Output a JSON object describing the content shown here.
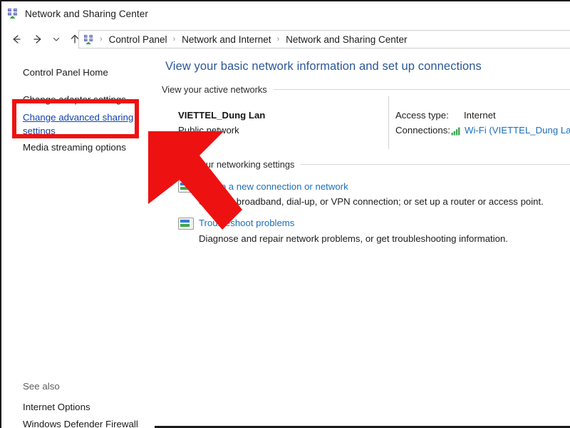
{
  "window": {
    "title": "Network and Sharing Center",
    "icon": "network-sharing-icon"
  },
  "navbar": {
    "back_icon": "back-arrow-icon",
    "forward_icon": "forward-arrow-icon",
    "recent_icon": "chevron-down-icon",
    "up_icon": "up-arrow-icon",
    "path_icon": "network-sharing-icon",
    "breadcrumbs": [
      "Control Panel",
      "Network and Internet",
      "Network and Sharing Center"
    ],
    "separator": "›"
  },
  "sidebar": {
    "items": [
      {
        "label": "Control Panel Home",
        "style": "plain"
      },
      {
        "label": "Change adapter settings",
        "style": "plain"
      },
      {
        "label": "Change advanced sharing",
        "style": "blue"
      },
      {
        "label": "settings",
        "style": "blue"
      },
      {
        "label": "Media streaming options",
        "style": "plain"
      }
    ],
    "see_also_heading": "See also",
    "see_also": [
      "Internet Options",
      "Windows Defender Firewall"
    ]
  },
  "main": {
    "heading": "View your basic network information and set up connections",
    "active_networks_label": "View your active networks",
    "network": {
      "name": "VIETTEL_Dung Lan",
      "type": "Public network",
      "access_type_label": "Access type:",
      "access_type_value": "Internet",
      "connections_label": "Connections:",
      "connections_icon": "wifi-signal-icon",
      "connections_value": "Wi-Fi (VIETTEL_Dung Lan)"
    },
    "networking_settings_label": "Change your networking settings",
    "setup_connection": {
      "link": "Set up a new connection or network",
      "description": "Set up a broadband, dial-up, or VPN connection; or set up a router or access point.",
      "icon": "setup-connection-icon"
    },
    "troubleshoot": {
      "link": "Troubleshoot problems",
      "description": "Diagnose and repair network problems, or get troubleshooting information.",
      "icon": "troubleshoot-icon"
    }
  },
  "annotations": {
    "highlight_box": {
      "color": "#ee1111",
      "target": "Change advanced sharing settings"
    },
    "arrow": {
      "color": "#ee1111",
      "direction": "up-left",
      "points_at": "Change advanced sharing settings"
    }
  }
}
